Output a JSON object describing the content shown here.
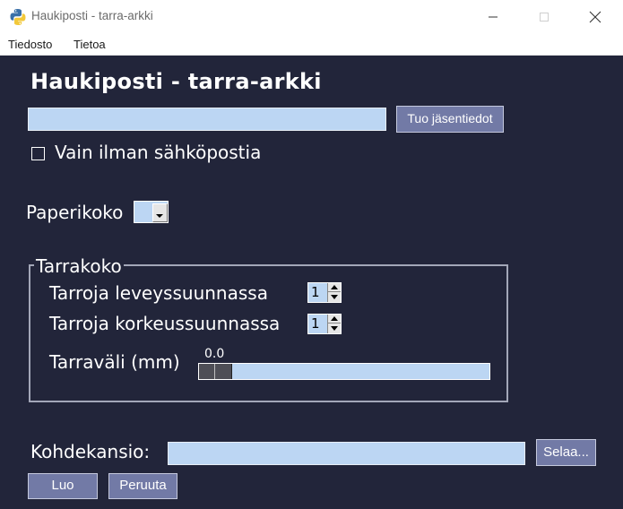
{
  "window": {
    "title": "Haukiposti - tarra-arkki",
    "icon": "python-icon"
  },
  "menu": {
    "items": [
      {
        "label": "Tiedosto"
      },
      {
        "label": "Tietoa"
      }
    ]
  },
  "form": {
    "heading": "Haukiposti - tarra-arkki",
    "member_input_value": "",
    "import_button": "Tuo jäsentiedot",
    "no_email_checkbox": {
      "label": "Vain ilman sähköpostia",
      "checked": false
    },
    "paper_size": {
      "label": "Paperikoko",
      "selected": ""
    },
    "label_size": {
      "frame_label": "Tarrakoko",
      "across": {
        "label": "Tarroja leveyssuunnassa",
        "value": "1"
      },
      "down": {
        "label": "Tarroja korkeussuunnassa",
        "value": "1"
      },
      "gap": {
        "label": "Tarraväli (mm)",
        "value": "0.0"
      }
    },
    "target_folder": {
      "label": "Kohdekansio:",
      "value": "",
      "browse_button": "Selaa..."
    },
    "create_button": "Luo",
    "cancel_button": "Peruuta"
  },
  "colors": {
    "background": "#22253a",
    "entry": "#bcd6f3",
    "button": "#727aa6",
    "text": "#ffffff"
  }
}
